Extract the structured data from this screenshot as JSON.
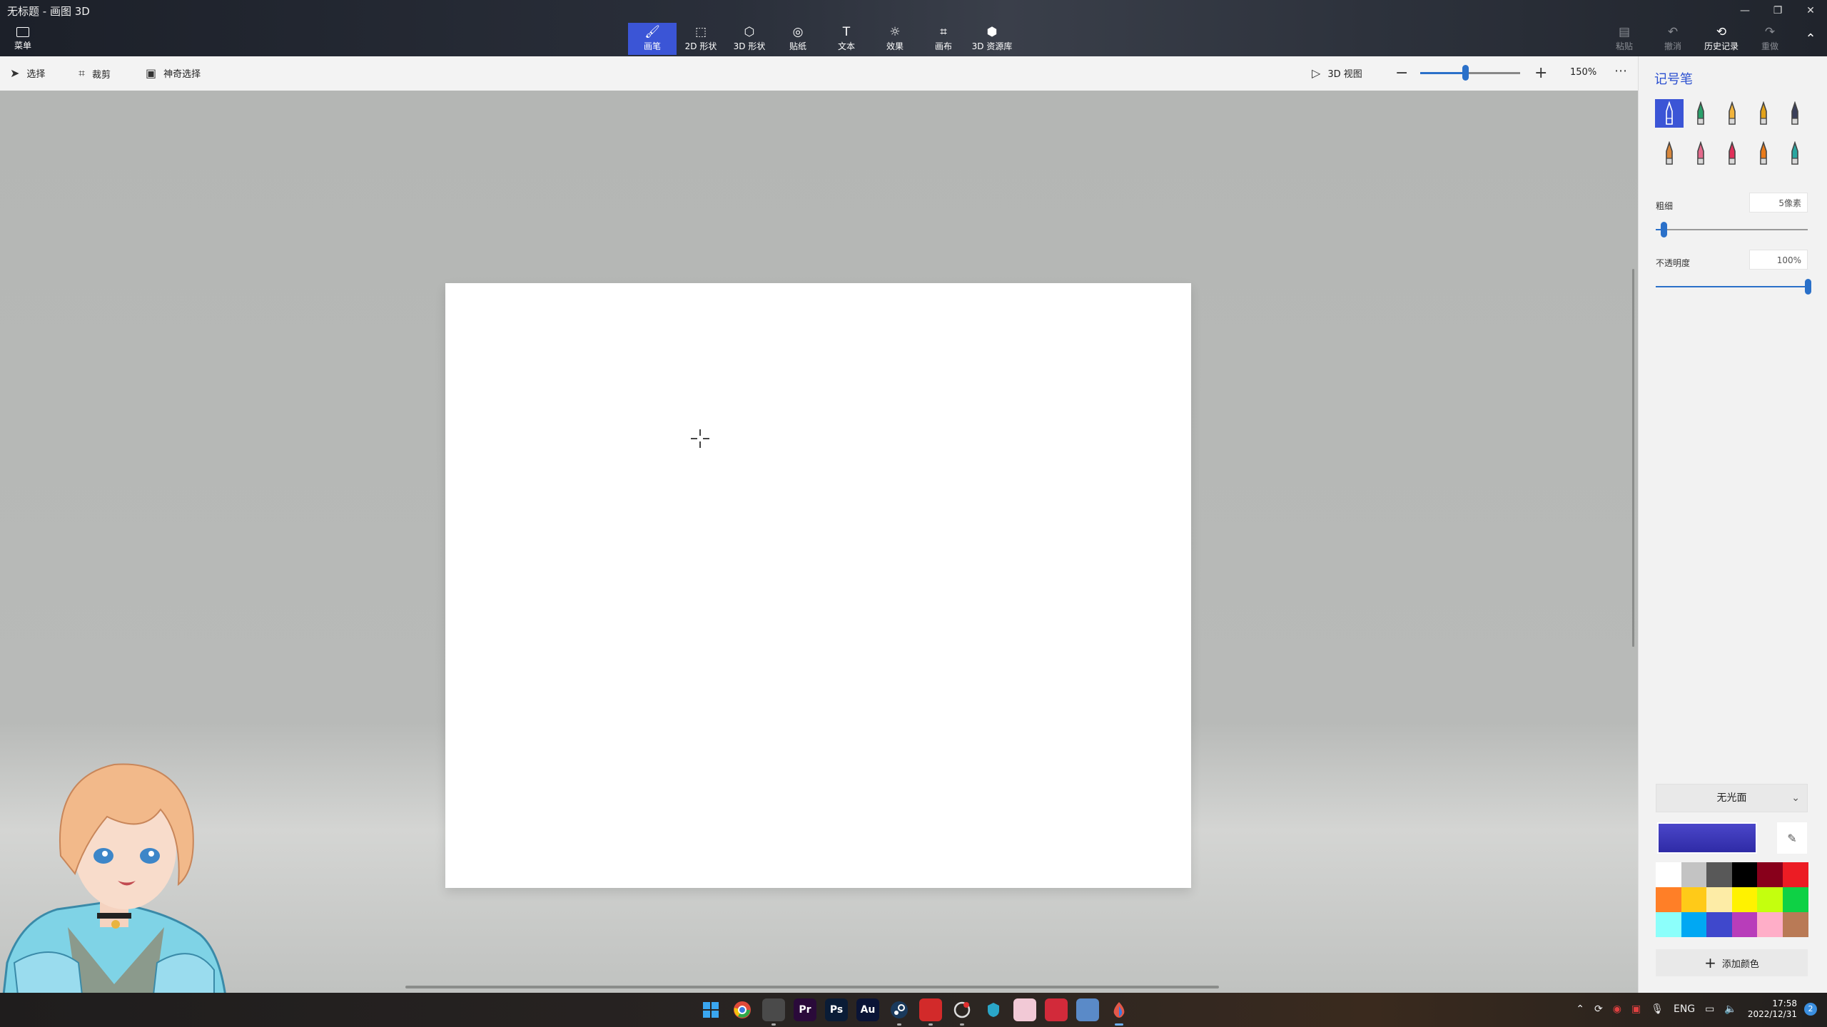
{
  "window": {
    "title": "无标题 - 画图 3D",
    "controls": [
      "minimize",
      "restore",
      "close"
    ]
  },
  "menu": {
    "label": "菜单"
  },
  "tools": [
    {
      "label": "画笔",
      "icon": "brush-icon",
      "glyph": "🖌",
      "active": true
    },
    {
      "label": "2D 形状",
      "icon": "shape-2d-icon",
      "glyph": "⬚",
      "active": false
    },
    {
      "label": "3D 形状",
      "icon": "shape-3d-icon",
      "glyph": "⬡",
      "active": false
    },
    {
      "label": "贴纸",
      "icon": "sticker-icon",
      "glyph": "◎",
      "active": false
    },
    {
      "label": "文本",
      "icon": "text-icon",
      "glyph": "T",
      "active": false
    },
    {
      "label": "效果",
      "icon": "effects-icon",
      "glyph": "☼",
      "active": false
    },
    {
      "label": "画布",
      "icon": "canvas-icon",
      "glyph": "⌗",
      "active": false
    },
    {
      "label": "3D 资源库",
      "icon": "library-3d-icon",
      "glyph": "⬢",
      "active": false
    }
  ],
  "right_actions": [
    {
      "label": "粘贴",
      "icon": "paste-icon",
      "glyph": "▤",
      "enabled": false
    },
    {
      "label": "撤消",
      "icon": "undo-icon",
      "glyph": "↶",
      "enabled": false
    },
    {
      "label": "历史记录",
      "icon": "history-icon",
      "glyph": "⟲",
      "enabled": true
    },
    {
      "label": "重做",
      "icon": "redo-icon",
      "glyph": "↷",
      "enabled": false
    }
  ],
  "subbar": {
    "select": "选择",
    "crop": "裁剪",
    "magic_select": "神奇选择",
    "view_3d": "3D 视图",
    "zoom": "150%",
    "zoom_level": 0.45
  },
  "panel": {
    "title": "记号笔",
    "thickness_label": "粗细",
    "thickness_value": "5像素",
    "thickness_level": 0.05,
    "opacity_label": "不透明度",
    "opacity_value": "100%",
    "opacity_level": 1.0,
    "finish": "无光面",
    "add_color": "添加颜色",
    "current_color": "#3d39b8",
    "brushes": [
      {
        "name": "marker-icon",
        "color": "#ffffff",
        "active": true
      },
      {
        "name": "calligraphy-pen-icon",
        "color": "#2aa06b",
        "active": false
      },
      {
        "name": "oil-brush-icon",
        "color": "#f2b43c",
        "active": false
      },
      {
        "name": "watercolor-icon",
        "color": "#e2a21a",
        "active": false
      },
      {
        "name": "pixel-pen-icon",
        "color": "#3a3f5a",
        "active": false
      },
      {
        "name": "pencil-icon",
        "color": "#d8873c",
        "active": false
      },
      {
        "name": "eraser-icon",
        "color": "#e46a8c",
        "active": false
      },
      {
        "name": "crayon-icon",
        "color": "#e0305a",
        "active": false
      },
      {
        "name": "spray-can-icon",
        "color": "#e87a1a",
        "active": false
      },
      {
        "name": "fill-icon",
        "color": "#2aa6a0",
        "active": false
      }
    ],
    "palette": [
      "#ffffff",
      "#c3c3c3",
      "#585858",
      "#000000",
      "#88001b",
      "#ec1c24",
      "#ff7f27",
      "#ffca18",
      "#fdeca6",
      "#fff200",
      "#c4ff0e",
      "#0ed145",
      "#8cfffb",
      "#00a8f3",
      "#3f48cc",
      "#b83dba",
      "#ffaec8",
      "#b97a56"
    ]
  },
  "taskbar": {
    "apps": [
      {
        "name": "start-icon",
        "label": "",
        "bg": "transparent"
      },
      {
        "name": "chrome-icon",
        "label": "",
        "bg": "transparent"
      },
      {
        "name": "explorer-app-icon",
        "label": "",
        "bg": "#4a4a4a"
      },
      {
        "name": "premiere-icon",
        "label": "Pr",
        "bg": "#2a0a3a"
      },
      {
        "name": "photoshop-icon",
        "label": "Ps",
        "bg": "#0a1c36"
      },
      {
        "name": "audition-icon",
        "label": "Au",
        "bg": "#0a1436"
      },
      {
        "name": "steam-icon",
        "label": "",
        "bg": "transparent"
      },
      {
        "name": "netease-music-icon",
        "label": "",
        "bg": "#d22a2a"
      },
      {
        "name": "app-circle-icon",
        "label": "",
        "bg": "transparent"
      },
      {
        "name": "app-shield-icon",
        "label": "",
        "bg": "transparent"
      },
      {
        "name": "app-pink-icon",
        "label": "",
        "bg": "#f2c9d6"
      },
      {
        "name": "app-red-icon",
        "label": "",
        "bg": "#d22a3a"
      },
      {
        "name": "app-blue-icon",
        "label": "",
        "bg": "#5a8ac8"
      },
      {
        "name": "paint3d-icon",
        "label": "",
        "bg": "transparent"
      }
    ],
    "lang": "ENG",
    "time": "17:58",
    "date": "2022/12/31",
    "notifications": "2"
  }
}
